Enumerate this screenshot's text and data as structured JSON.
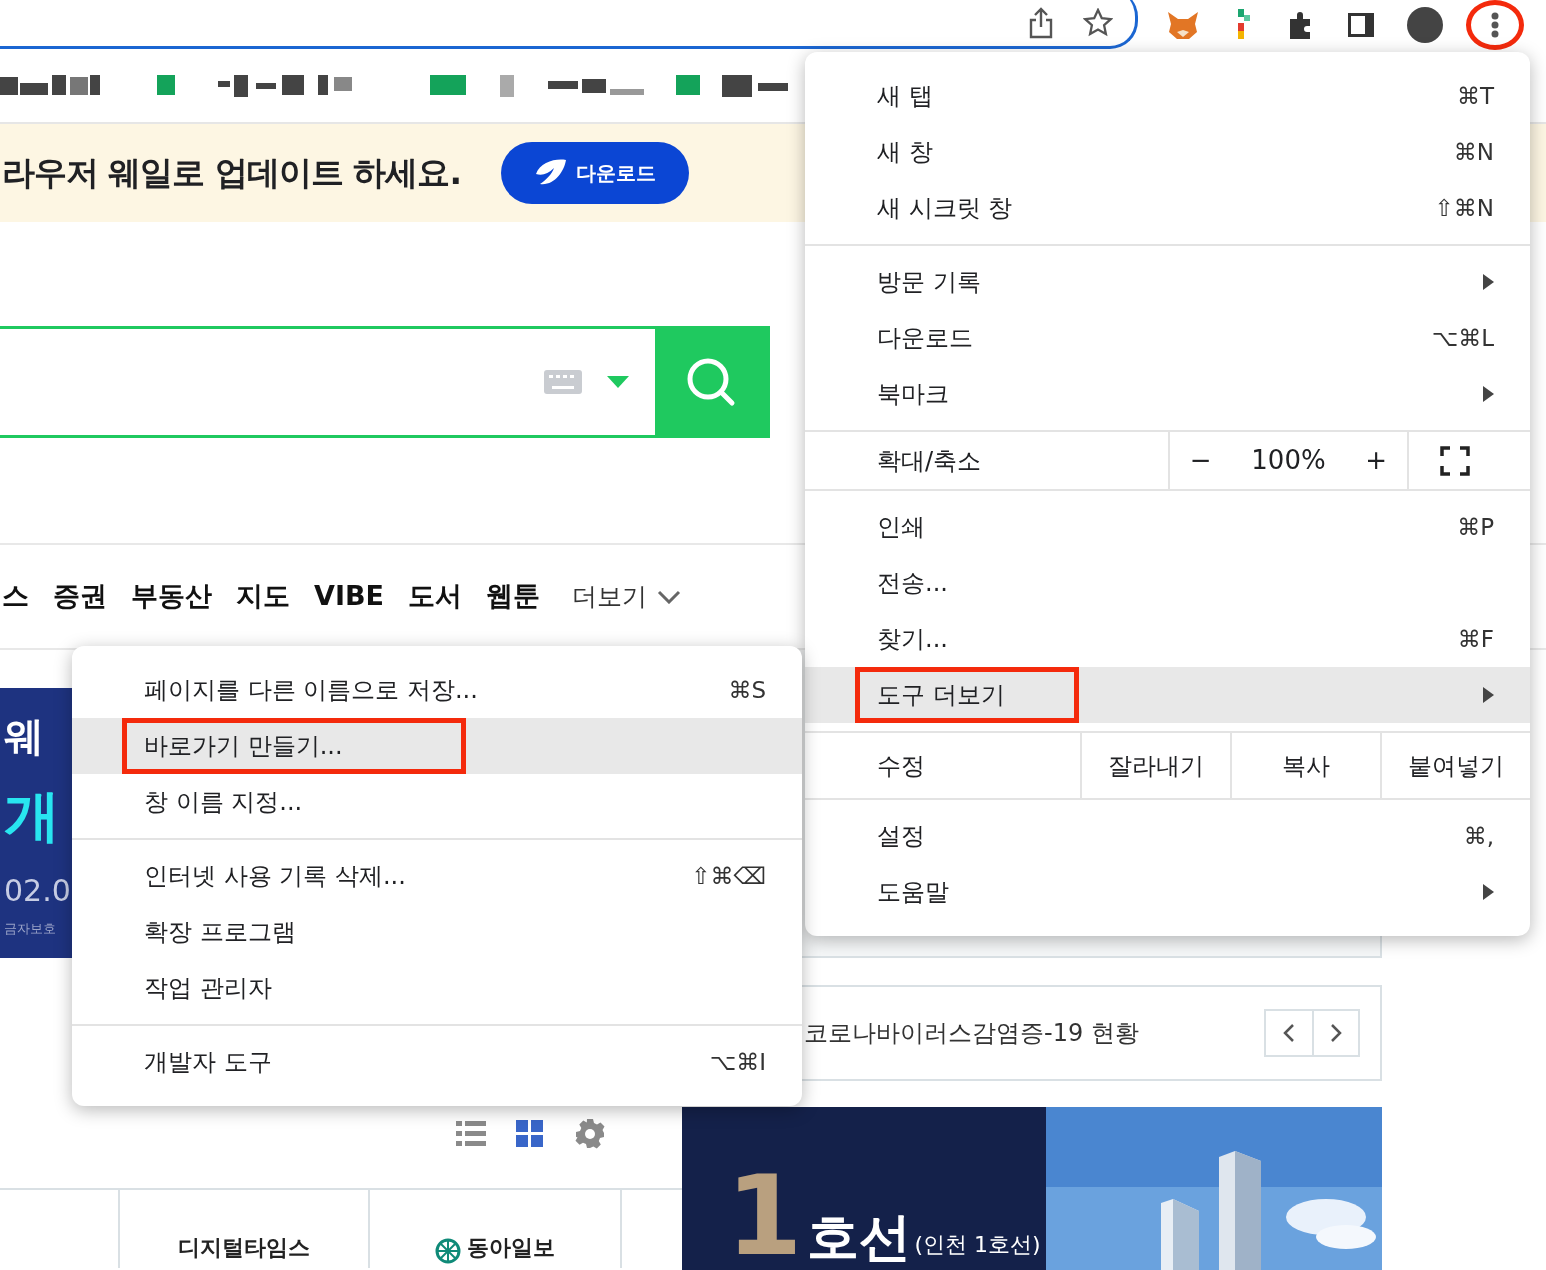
{
  "menu_button": {
    "annotated": true
  },
  "banner": {
    "text": "라우저 웨일로 업데이트 하세요.",
    "button": "다운로드"
  },
  "nav": {
    "items": [
      "스",
      "증권",
      "부동산",
      "지도",
      "VIBE",
      "도서",
      "웹툰"
    ],
    "more": "더보기"
  },
  "promo": {
    "lines": [
      "웨",
      "개",
      "02.0",
      "금자보호"
    ]
  },
  "corona": {
    "title": "코로나바이러스감염증-19 현황"
  },
  "view_toggle": [
    {
      "kind": "list",
      "selected": false
    },
    {
      "kind": "grid",
      "selected": true
    }
  ],
  "press": [
    "디지털타임스",
    "동아일보"
  ],
  "ad": {
    "number": "1",
    "title": "호선",
    "subtitle": "(인천 1호선)"
  },
  "main_menu": {
    "sections": [
      {
        "items": [
          {
            "kind": "item",
            "label": "새 탭",
            "shortcut": "⌘T",
            "submenu": false,
            "selected": false,
            "annotated": false
          },
          {
            "kind": "item",
            "label": "새 창",
            "shortcut": "⌘N",
            "submenu": false,
            "selected": false,
            "annotated": false
          },
          {
            "kind": "item",
            "label": "새 시크릿 창",
            "shortcut": "⇧⌘N",
            "submenu": false,
            "selected": false,
            "annotated": false
          }
        ]
      },
      {
        "items": [
          {
            "kind": "item",
            "label": "방문 기록",
            "submenu": true,
            "selected": false,
            "annotated": false
          },
          {
            "kind": "item",
            "label": "다운로드",
            "shortcut": "⌥⌘L",
            "submenu": false,
            "selected": false,
            "annotated": false
          },
          {
            "kind": "item",
            "label": "북마크",
            "submenu": true,
            "selected": false,
            "annotated": false
          }
        ]
      },
      {
        "items": [
          {
            "kind": "zoom",
            "label": "확대/축소",
            "minus": "−",
            "value": "100%",
            "plus": "+"
          }
        ]
      },
      {
        "items": [
          {
            "kind": "item",
            "label": "인쇄",
            "shortcut": "⌘P",
            "submenu": false,
            "selected": false,
            "annotated": false
          },
          {
            "kind": "item",
            "label": "전송...",
            "submenu": false,
            "selected": false,
            "annotated": false
          },
          {
            "kind": "item",
            "label": "찾기...",
            "shortcut": "⌘F",
            "submenu": false,
            "selected": false,
            "annotated": false
          },
          {
            "kind": "item",
            "label": "도구 더보기",
            "submenu": true,
            "selected": true,
            "annotated": true
          }
        ]
      },
      {
        "items": [
          {
            "kind": "edit",
            "label": "수정",
            "buttons": [
              "잘라내기",
              "복사",
              "붙여넣기"
            ]
          }
        ]
      },
      {
        "items": [
          {
            "kind": "item",
            "label": "설정",
            "shortcut": "⌘,",
            "submenu": false,
            "selected": false,
            "annotated": false
          },
          {
            "kind": "item",
            "label": "도움말",
            "submenu": true,
            "selected": false,
            "annotated": false
          }
        ]
      }
    ]
  },
  "submenu": {
    "sections": [
      {
        "items": [
          {
            "kind": "item",
            "label": "페이지를 다른 이름으로 저장...",
            "shortcut": "⌘S",
            "submenu": false,
            "selected": false,
            "annotated": false
          },
          {
            "kind": "item",
            "label": "바로가기 만들기...",
            "submenu": false,
            "selected": true,
            "annotated": true
          },
          {
            "kind": "item",
            "label": "창 이름 지정...",
            "submenu": false,
            "selected": false,
            "annotated": false
          }
        ]
      },
      {
        "items": [
          {
            "kind": "item",
            "label": "인터넷 사용 기록 삭제...",
            "shortcut": "⇧⌘⌫",
            "submenu": false,
            "selected": false,
            "annotated": false
          },
          {
            "kind": "item",
            "label": "확장 프로그램",
            "submenu": false,
            "selected": false,
            "annotated": false
          },
          {
            "kind": "item",
            "label": "작업 관리자",
            "submenu": false,
            "selected": false,
            "annotated": false
          }
        ]
      },
      {
        "items": [
          {
            "kind": "item",
            "label": "개발자 도구",
            "shortcut": "⌥⌘I",
            "submenu": false,
            "selected": false,
            "annotated": false
          }
        ]
      }
    ]
  }
}
